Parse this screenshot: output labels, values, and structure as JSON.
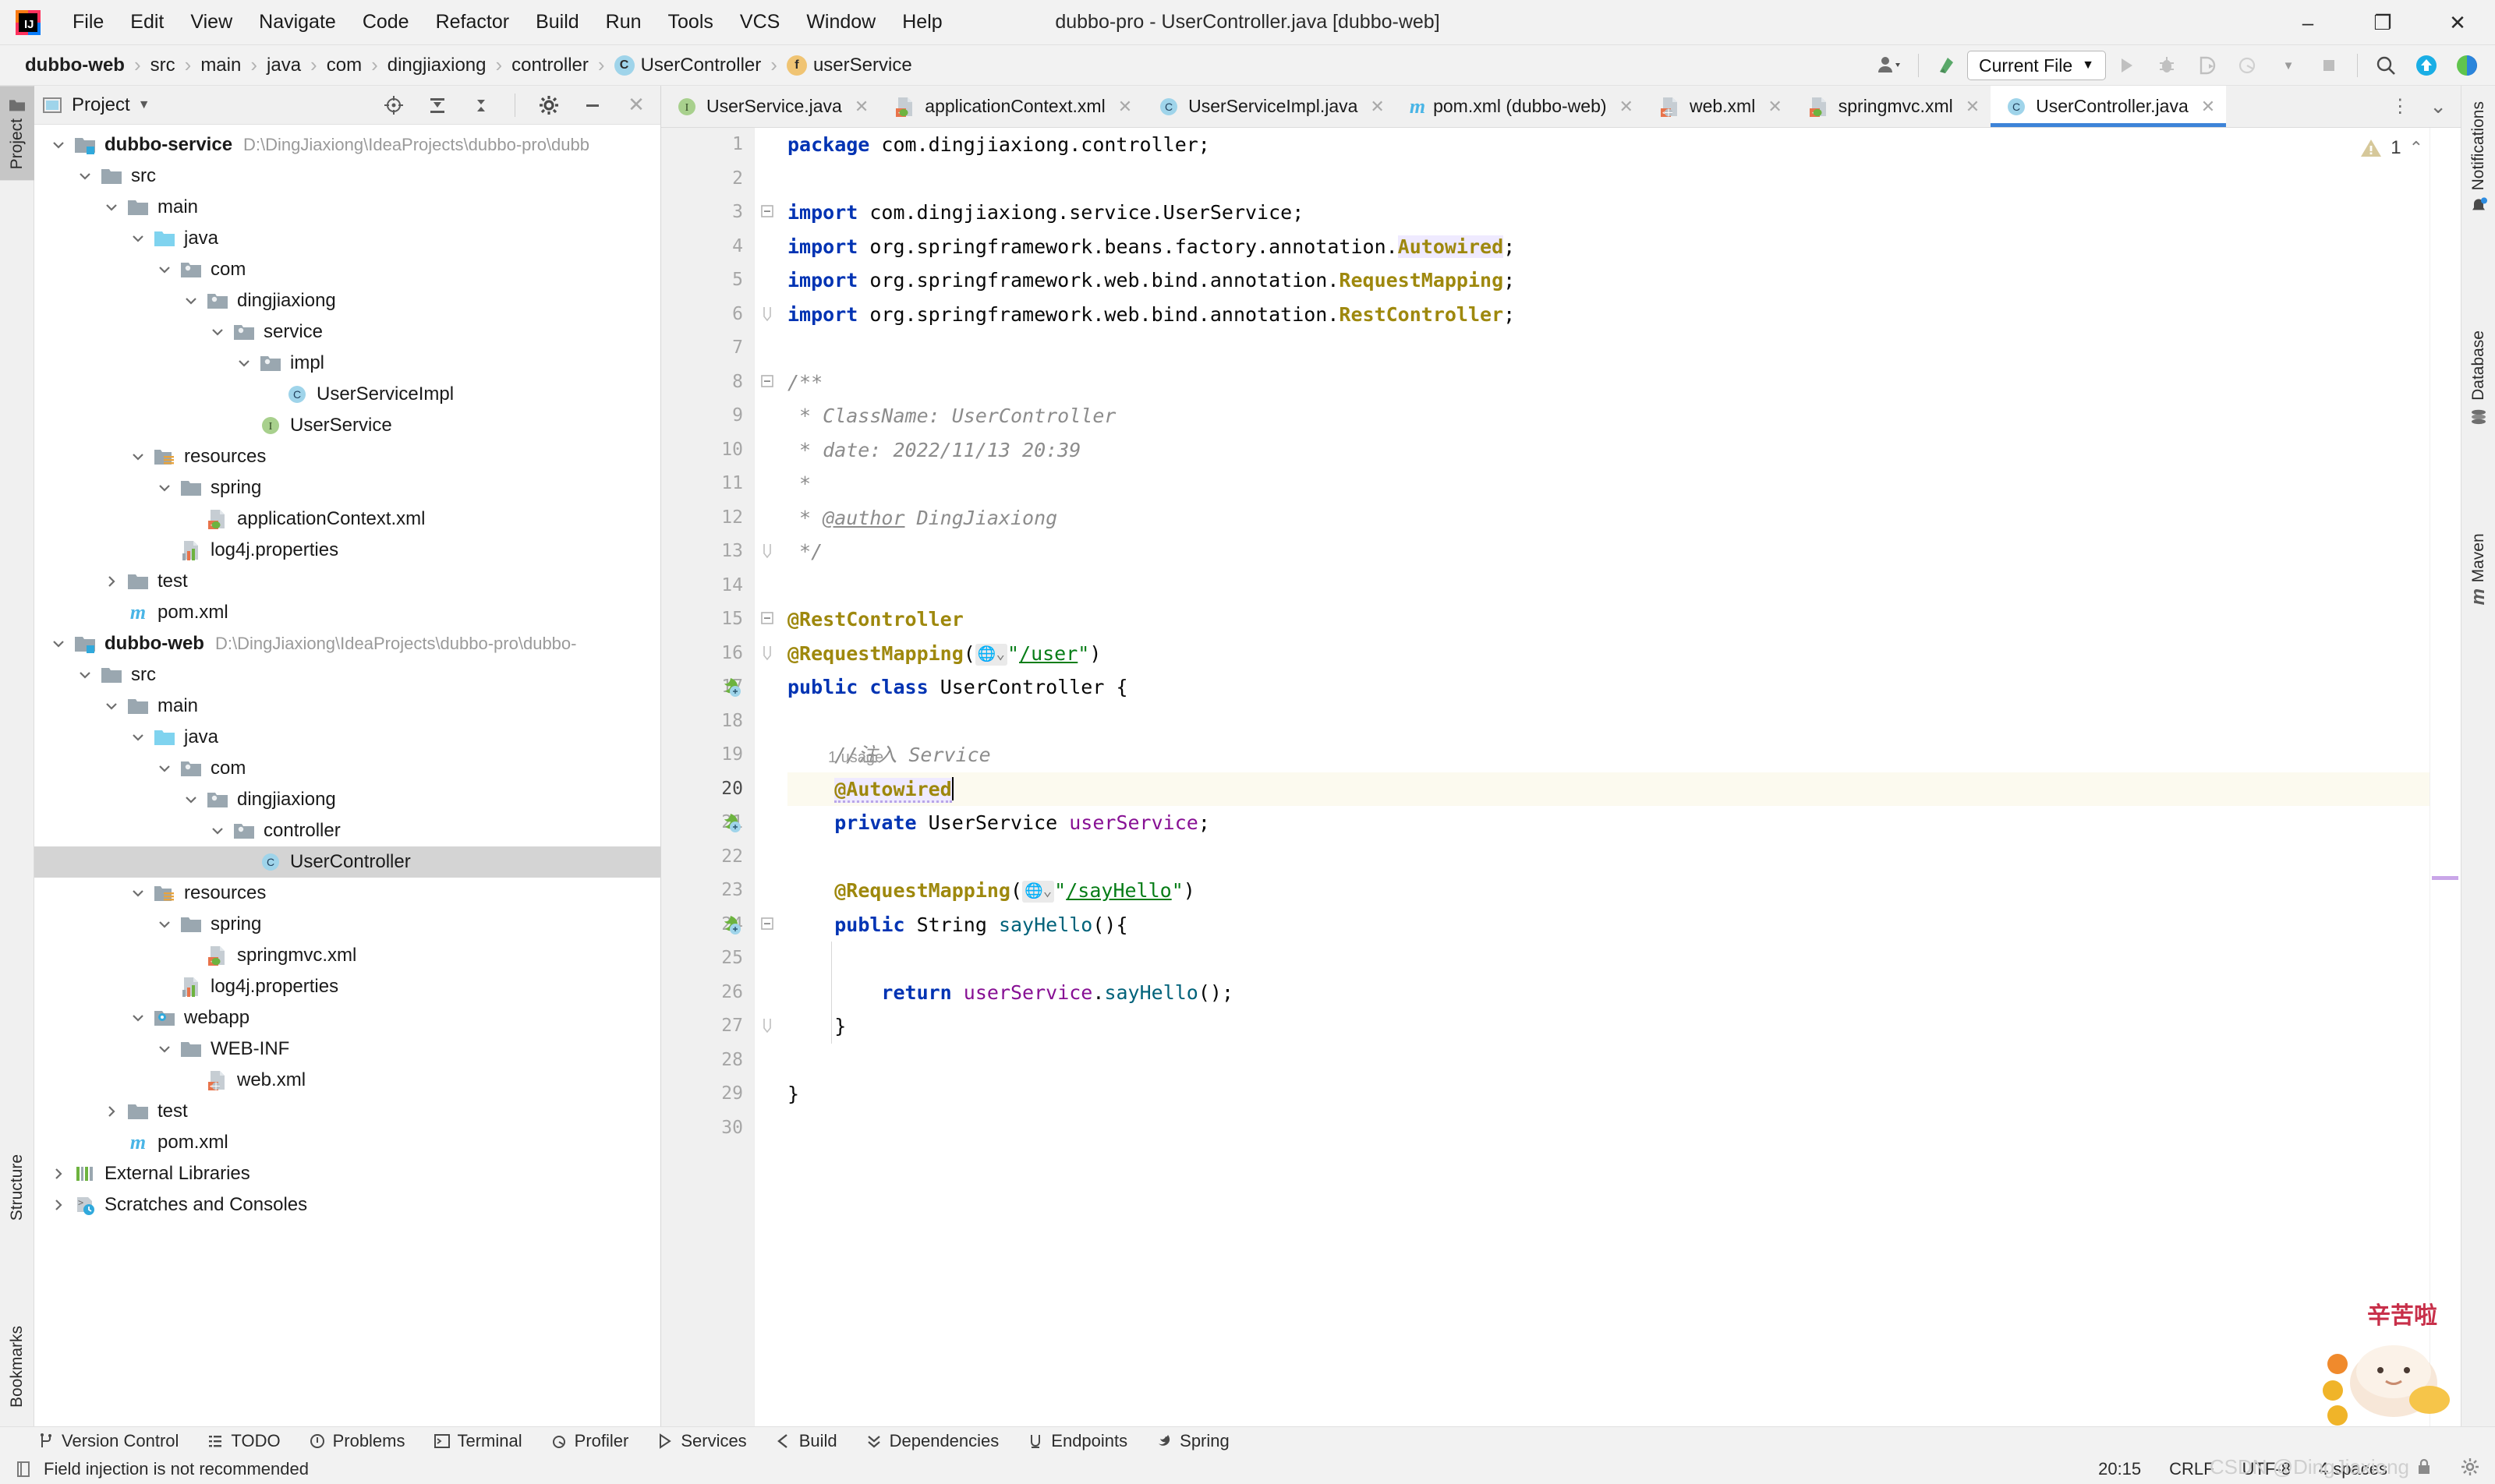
{
  "window": {
    "title": "dubbo-pro - UserController.java [dubbo-web]",
    "minimize": "–",
    "maximize": "❐",
    "close": "✕"
  },
  "menubar": {
    "items": [
      {
        "label": "File"
      },
      {
        "label": "Edit"
      },
      {
        "label": "View"
      },
      {
        "label": "Navigate"
      },
      {
        "label": "Code"
      },
      {
        "label": "Refactor"
      },
      {
        "label": "Build"
      },
      {
        "label": "Run"
      },
      {
        "label": "Tools"
      },
      {
        "label": "VCS"
      },
      {
        "label": "Window"
      },
      {
        "label": "Help"
      }
    ]
  },
  "breadcrumb": {
    "items": [
      {
        "label": "dubbo-web",
        "icon": "",
        "bold": true
      },
      {
        "label": "src",
        "icon": ""
      },
      {
        "label": "main",
        "icon": ""
      },
      {
        "label": "java",
        "icon": ""
      },
      {
        "label": "com",
        "icon": ""
      },
      {
        "label": "dingjiaxiong",
        "icon": ""
      },
      {
        "label": "controller",
        "icon": ""
      },
      {
        "label": "UserController",
        "icon": "C"
      },
      {
        "label": "userService",
        "icon": "f"
      }
    ],
    "separator": "›"
  },
  "toolbar": {
    "run_config": "Current File",
    "chevron": "▼",
    "icons": [
      "user-settings-icon",
      "vcs-update-icon",
      "run-icon",
      "debug-icon",
      "run-coverage-icon",
      "profile-icon",
      "stop-icon",
      "search-everywhere-icon",
      "update-project-icon",
      "ide-eye-icon"
    ]
  },
  "left_strip": {
    "tabs": [
      {
        "label": "Project",
        "active": true
      },
      {
        "label": "Structure",
        "active": false
      },
      {
        "label": "Bookmarks",
        "active": false
      }
    ]
  },
  "right_strip": {
    "tabs": [
      {
        "label": "Notifications"
      },
      {
        "label": "Database"
      },
      {
        "label": "Maven"
      }
    ]
  },
  "project_panel": {
    "title": "Project",
    "title_chevron": "▼",
    "actions": [
      "select-opened-file-icon",
      "expand-all-icon",
      "collapse-all-icon",
      "settings-gear-icon",
      "hide-icon",
      "close-icon"
    ],
    "tree": [
      {
        "depth": 0,
        "twist": "v",
        "icon": "module",
        "label": "dubbo-service",
        "bold": true,
        "path": "D:\\DingJiaxiong\\IdeaProjects\\dubbo-pro\\dubb"
      },
      {
        "depth": 1,
        "twist": "v",
        "icon": "folder",
        "label": "src"
      },
      {
        "depth": 2,
        "twist": "v",
        "icon": "folder",
        "label": "main"
      },
      {
        "depth": 3,
        "twist": "v",
        "icon": "folder-src",
        "label": "java"
      },
      {
        "depth": 4,
        "twist": "v",
        "icon": "package",
        "label": "com"
      },
      {
        "depth": 5,
        "twist": "v",
        "icon": "package",
        "label": "dingjiaxiong"
      },
      {
        "depth": 6,
        "twist": "v",
        "icon": "package",
        "label": "service"
      },
      {
        "depth": 7,
        "twist": "v",
        "icon": "package",
        "label": "impl"
      },
      {
        "depth": 8,
        "twist": "",
        "icon": "class",
        "label": "UserServiceImpl"
      },
      {
        "depth": 7,
        "twist": "",
        "icon": "interface",
        "label": "UserService"
      },
      {
        "depth": 3,
        "twist": "v",
        "icon": "folder-res",
        "label": "resources"
      },
      {
        "depth": 4,
        "twist": "v",
        "icon": "folder",
        "label": "spring"
      },
      {
        "depth": 5,
        "twist": "",
        "icon": "spring-xml",
        "label": "applicationContext.xml"
      },
      {
        "depth": 4,
        "twist": "",
        "icon": "properties",
        "label": "log4j.properties"
      },
      {
        "depth": 2,
        "twist": ">",
        "icon": "folder",
        "label": "test"
      },
      {
        "depth": 2,
        "twist": "",
        "icon": "maven",
        "label": "pom.xml"
      },
      {
        "depth": 0,
        "twist": "v",
        "icon": "module",
        "label": "dubbo-web",
        "bold": true,
        "path": "D:\\DingJiaxiong\\IdeaProjects\\dubbo-pro\\dubbo-"
      },
      {
        "depth": 1,
        "twist": "v",
        "icon": "folder",
        "label": "src"
      },
      {
        "depth": 2,
        "twist": "v",
        "icon": "folder",
        "label": "main"
      },
      {
        "depth": 3,
        "twist": "v",
        "icon": "folder-src",
        "label": "java"
      },
      {
        "depth": 4,
        "twist": "v",
        "icon": "package",
        "label": "com"
      },
      {
        "depth": 5,
        "twist": "v",
        "icon": "package",
        "label": "dingjiaxiong"
      },
      {
        "depth": 6,
        "twist": "v",
        "icon": "package",
        "label": "controller"
      },
      {
        "depth": 7,
        "twist": "",
        "icon": "class",
        "label": "UserController",
        "selected": true
      },
      {
        "depth": 3,
        "twist": "v",
        "icon": "folder-res",
        "label": "resources"
      },
      {
        "depth": 4,
        "twist": "v",
        "icon": "folder",
        "label": "spring"
      },
      {
        "depth": 5,
        "twist": "",
        "icon": "spring-xml",
        "label": "springmvc.xml"
      },
      {
        "depth": 4,
        "twist": "",
        "icon": "properties",
        "label": "log4j.properties"
      },
      {
        "depth": 3,
        "twist": "v",
        "icon": "folder-web",
        "label": "webapp"
      },
      {
        "depth": 4,
        "twist": "v",
        "icon": "folder",
        "label": "WEB-INF"
      },
      {
        "depth": 5,
        "twist": "",
        "icon": "web-xml",
        "label": "web.xml"
      },
      {
        "depth": 2,
        "twist": ">",
        "icon": "folder",
        "label": "test"
      },
      {
        "depth": 2,
        "twist": "",
        "icon": "maven",
        "label": "pom.xml"
      },
      {
        "depth": 0,
        "twist": ">",
        "icon": "libraries",
        "label": "External Libraries"
      },
      {
        "depth": 0,
        "twist": ">",
        "icon": "scratches",
        "label": "Scratches and Consoles"
      }
    ]
  },
  "editor": {
    "tabs": [
      {
        "label": "UserService.java",
        "icon": "interface",
        "active": false,
        "close": "✕"
      },
      {
        "label": "applicationContext.xml",
        "icon": "spring-xml",
        "active": false,
        "close": "✕"
      },
      {
        "label": "UserServiceImpl.java",
        "icon": "class",
        "active": false,
        "close": "✕"
      },
      {
        "label": "pom.xml (dubbo-web)",
        "icon": "maven",
        "active": false,
        "close": "✕"
      },
      {
        "label": "web.xml",
        "icon": "web-xml",
        "active": false,
        "close": "✕"
      },
      {
        "label": "springmvc.xml",
        "icon": "spring-xml",
        "active": false,
        "close": "✕"
      },
      {
        "label": "UserController.java",
        "icon": "class",
        "active": true,
        "close": "✕"
      }
    ],
    "tab_overflow": "⋮",
    "tab_chevron": "⌄",
    "warning_count": "1",
    "warning_chevron": "⌃",
    "line_numbers": [
      "1",
      "2",
      "3",
      "4",
      "5",
      "6",
      "7",
      "8",
      "9",
      "10",
      "11",
      "12",
      "13",
      "14",
      "15",
      "16",
      "17",
      "18",
      "19",
      "20",
      "21",
      "22",
      "23",
      "24",
      "25",
      "26",
      "27",
      "28",
      "29",
      "30"
    ],
    "current_line": "20",
    "code_lines": [
      {
        "n": 1,
        "text": "package com.dingjiaxiong.controller;"
      },
      {
        "n": 2,
        "text": ""
      },
      {
        "n": 3,
        "text": "import com.dingjiaxiong.service.UserService;"
      },
      {
        "n": 4,
        "text": "import org.springframework.beans.factory.annotation.Autowired;"
      },
      {
        "n": 5,
        "text": "import org.springframework.web.bind.annotation.RequestMapping;"
      },
      {
        "n": 6,
        "text": "import org.springframework.web.bind.annotation.RestController;"
      },
      {
        "n": 7,
        "text": ""
      },
      {
        "n": 8,
        "text": "/**"
      },
      {
        "n": 9,
        "text": " * ClassName: UserController"
      },
      {
        "n": 10,
        "text": " * date: 2022/11/13 20:39"
      },
      {
        "n": 11,
        "text": " *"
      },
      {
        "n": 12,
        "text": " * @author DingJiaxiong"
      },
      {
        "n": 13,
        "text": " */"
      },
      {
        "n": 14,
        "text": ""
      },
      {
        "n": 15,
        "text": "@RestController"
      },
      {
        "n": 16,
        "text": "@RequestMapping(\"/user\")"
      },
      {
        "n": 17,
        "text": "public class UserController {"
      },
      {
        "n": 18,
        "text": ""
      },
      {
        "n": 19,
        "text": "    //注入 Service"
      },
      {
        "n": 20,
        "text": "    @Autowired"
      },
      {
        "n": 21,
        "text": "    private UserService userService;"
      },
      {
        "n": 22,
        "text": ""
      },
      {
        "n": 23,
        "text": "    @RequestMapping(\"/sayHello\")"
      },
      {
        "n": 24,
        "text": "    public String sayHello(){"
      },
      {
        "n": 25,
        "text": ""
      },
      {
        "n": 26,
        "text": "        return userService.sayHello();"
      },
      {
        "n": 27,
        "text": "    }"
      },
      {
        "n": 28,
        "text": ""
      },
      {
        "n": 29,
        "text": "}"
      },
      {
        "n": 30,
        "text": ""
      }
    ],
    "inlay_usage_hint": "1 usage",
    "comment_inject": "//注入 Service",
    "mapping_user": "\"/user\"",
    "mapping_sayhello": "\"/sayHello\""
  },
  "bottom_bar": {
    "items": [
      {
        "label": "Version Control",
        "icon": "branch-icon"
      },
      {
        "label": "TODO",
        "icon": "todo-icon"
      },
      {
        "label": "Problems",
        "icon": "problems-icon"
      },
      {
        "label": "Terminal",
        "icon": "terminal-icon"
      },
      {
        "label": "Profiler",
        "icon": "profiler-icon"
      },
      {
        "label": "Services",
        "icon": "services-icon"
      },
      {
        "label": "Build",
        "icon": "build-icon"
      },
      {
        "label": "Dependencies",
        "icon": "dependencies-icon"
      },
      {
        "label": "Endpoints",
        "icon": "endpoints-icon"
      },
      {
        "label": "Spring",
        "icon": "spring-icon"
      }
    ]
  },
  "status_bar": {
    "message": "Field injection is not recommended",
    "caret_position": "20:15",
    "line_separator": "CRLF",
    "encoding": "UTF-8",
    "indent": "4 spaces",
    "watermark": "CSDN @DingJiaxiong"
  },
  "colors": {
    "accent_blue": "#3d83d8",
    "keyword": "#0033b3",
    "annotation": "#9e880d",
    "string": "#067d17",
    "comment": "#8c8c8c",
    "field": "#871094",
    "method": "#00627a",
    "selection": "#d4d4d4",
    "current_line": "#fcfaef"
  }
}
